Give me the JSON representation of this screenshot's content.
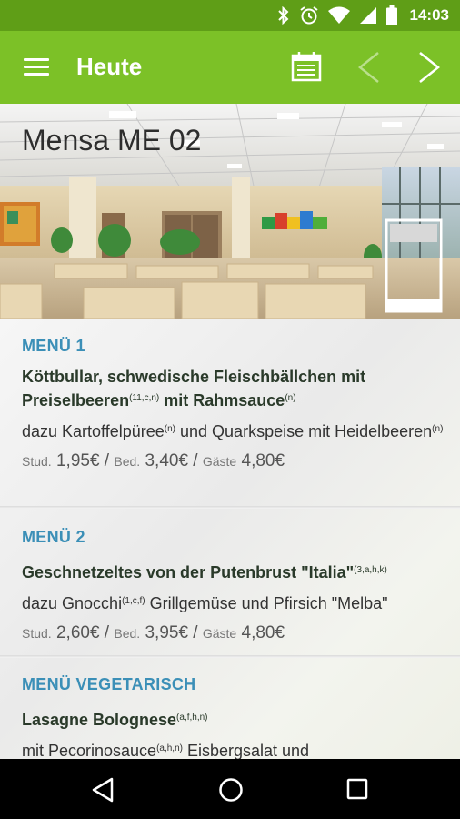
{
  "status_bar": {
    "time": "14:03"
  },
  "app_bar": {
    "title": "Heute"
  },
  "hero": {
    "title": "Mensa ME 02"
  },
  "menus": [
    {
      "heading": "MENÜ 1",
      "dish_a": "Köttbullar, schwedische Fleischbällchen mit Preiselbeeren",
      "dish_a_sup": "(11,c,n)",
      "dish_b": " mit Rahmsauce",
      "dish_b_sup": "(n)",
      "side_a": "dazu Kartoffelpüree",
      "side_a_sup": "(n)",
      "side_b": " und Quarkspeise mit Heidelbeeren",
      "side_b_sup": "(n)",
      "stud_label": "Stud.",
      "stud_price": "1,95€",
      "bed_label": "Bed.",
      "bed_price": "3,40€",
      "gast_label": "Gäste",
      "gast_price": "4,80€"
    },
    {
      "heading": "MENÜ 2",
      "dish_a": "Geschnetzeltes von der Putenbrust \"Italia\"",
      "dish_a_sup": "(3,a,h,k)",
      "side_a": "dazu Gnocchi",
      "side_a_sup": "(1,c,f)",
      "side_b": " Grillgemüse und Pfirsich \"Melba\"",
      "stud_label": "Stud.",
      "stud_price": "2,60€",
      "bed_label": "Bed.",
      "bed_price": "3,95€",
      "gast_label": "Gäste",
      "gast_price": "4,80€"
    },
    {
      "heading": "MENÜ VEGETARISCH",
      "dish_a": "Lasagne Bolognese",
      "dish_a_sup": "(a,f,h,n)",
      "side_a": "mit Pecorinosauce",
      "side_a_sup": "(a,h,n)",
      "side_b": " Eisbergsalat und"
    }
  ],
  "colors": {
    "status_bar": "#5f9e17",
    "app_bar": "#7cc127",
    "menu_heading": "#3b8fb7"
  },
  "icons": [
    "bluetooth-icon",
    "alarm-icon",
    "wifi-icon",
    "signal-icon",
    "battery-icon",
    "menu-icon",
    "calendar-icon",
    "chevron-left-icon",
    "chevron-right-icon",
    "back-icon",
    "home-icon",
    "recents-icon"
  ]
}
